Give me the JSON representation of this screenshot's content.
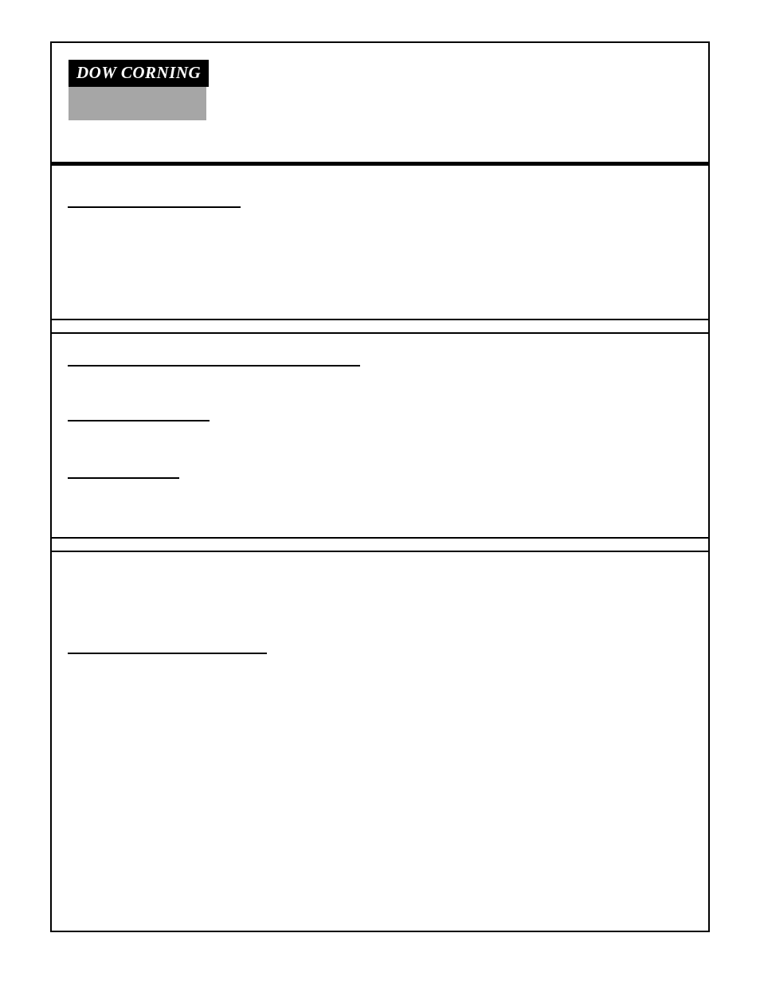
{
  "logo": {
    "brand_text": "DOW CORNING"
  }
}
